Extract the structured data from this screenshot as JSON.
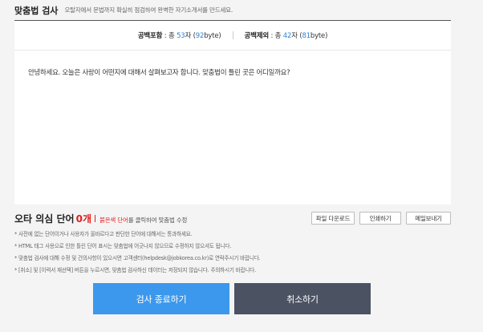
{
  "header": {
    "title": "맞춤법 검사",
    "subtitle": "오탈자에서 문법까지 확실히 점검하여 완벽한 자기소개서를 만드세요."
  },
  "counter": {
    "with_space": {
      "label": "공백포함",
      "prefix": " : 총 ",
      "chars": "53",
      "unit": "자 (",
      "bytes": "92",
      "suffix": "byte)"
    },
    "without_space": {
      "label": "공백제외",
      "prefix": " : 총 ",
      "chars": "42",
      "unit": "자 (",
      "bytes": "81",
      "suffix": "byte)"
    }
  },
  "editor": {
    "text": "안녕하세요. 오늘은 사랑이 어떤지에 대해서 살펴보고자 합니다. 맞춤법이 틀린 곳은 어디일까요?"
  },
  "errors": {
    "title": "오타 의심 단어",
    "count": "0개",
    "hint_red": "붉은색 단어",
    "hint_rest": "를 클릭하여 맞춤법 수정"
  },
  "actions": {
    "download": "파일 다운로드",
    "print": "인쇄하기",
    "email": "메일보내기"
  },
  "notes": [
    "* 사전에 없는 단어이거나 사용자가 올바르다고 판단한 단어에 대해서는 통과하세요.",
    "* HTML 태그 사용으로 인한 틀린 단어 표시는 맞춤법에 어긋나지 않으므로 수정하지 않으셔도 됩니다.",
    "* 맞춤법 검사에 대해 수정 및 건의사항이 있으시면 고객센터(helpdesk@jobkorea.co.kr)로 연락주시기 바랍니다.",
    "* [취소] 및 [이력서 재선택] 버튼을 누르시면, 맞춤법 검사하신 데이터는 저장되지 않습니다. 주의하시기 바랍니다."
  ],
  "buttons": {
    "finish": "검사 종료하기",
    "cancel": "취소하기"
  }
}
